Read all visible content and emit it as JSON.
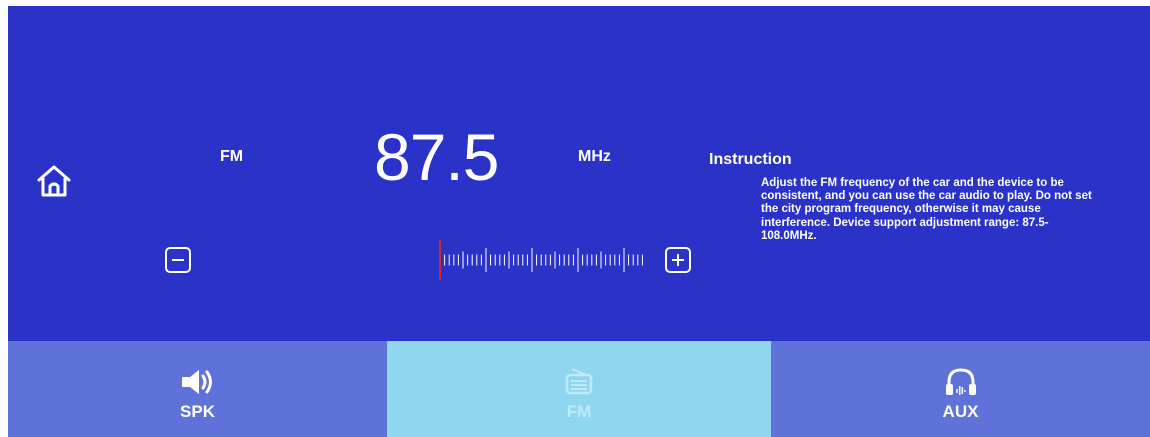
{
  "radio": {
    "band": "FM",
    "frequency": "87.5",
    "unit": "MHz",
    "tuner_position": 0.0
  },
  "instruction": {
    "title": "Instruction",
    "text": "Adjust the FM frequency of the car and the device to be consistent, and you can use the car audio to play. Do not set the city program frequency, otherwise it may cause interference. Device support adjustment range: 87.5-108.0MHz."
  },
  "tabs": {
    "spk": {
      "label": "SPK",
      "icon": "speaker-icon",
      "selected": false
    },
    "fm": {
      "label": "FM",
      "icon": "radio-icon",
      "selected": true
    },
    "aux": {
      "label": "AUX",
      "icon": "headphones-icon",
      "selected": false
    }
  },
  "colors": {
    "background": "#2a32c8",
    "tab_bar": "#5f72da",
    "tab_selected": "#8fd7ef",
    "tuner_marker": "#d22a2a",
    "foreground": "#ffffff"
  }
}
